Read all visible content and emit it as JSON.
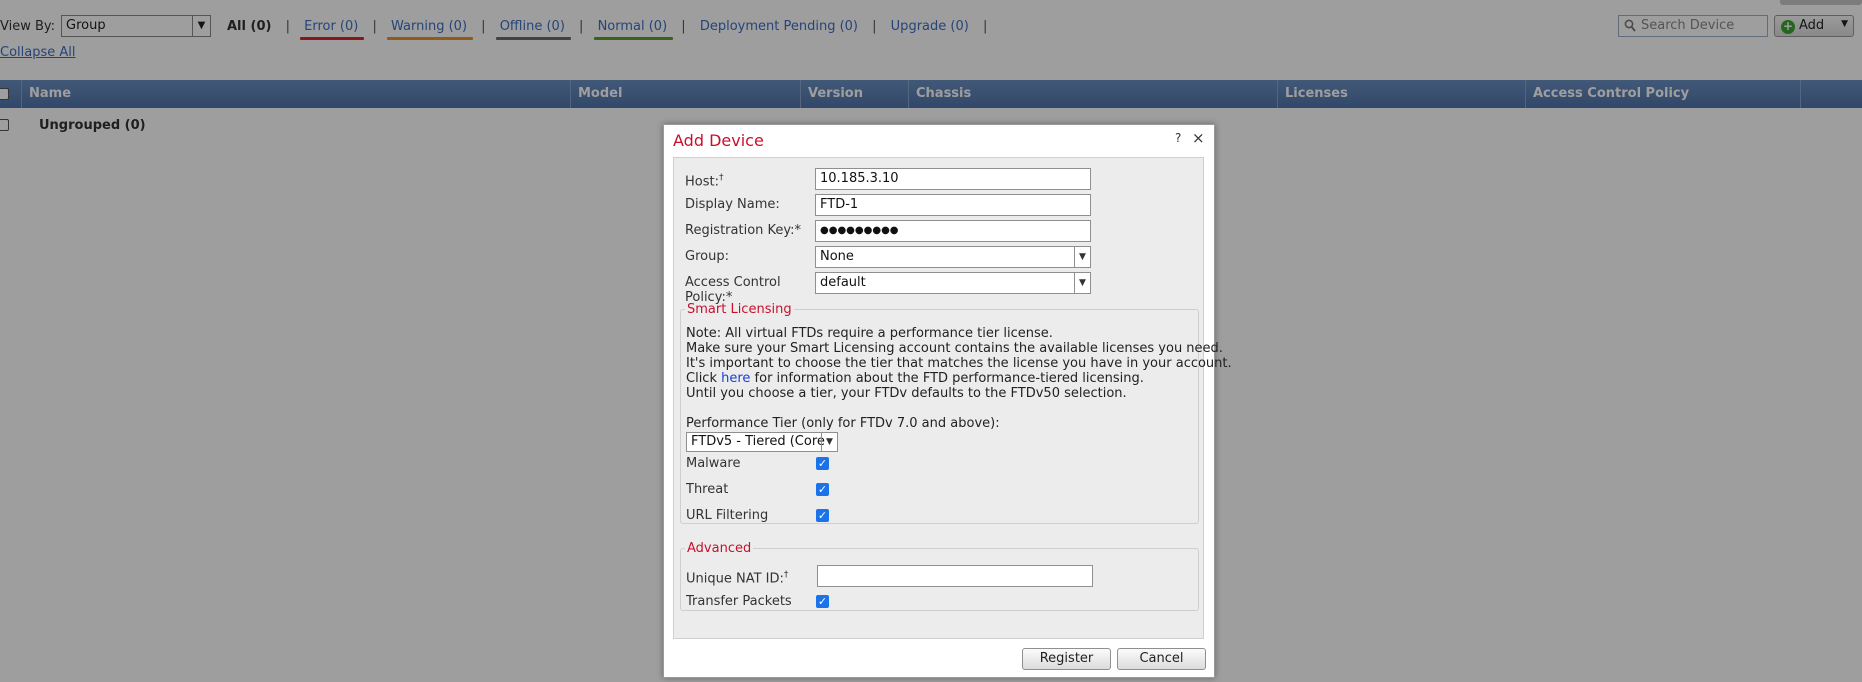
{
  "toolbar": {
    "viewby_label": "View By:",
    "viewby_value": "Group",
    "filters": {
      "all": "All (0)",
      "error": "Error (0)",
      "warning": "Warning (0)",
      "offline": "Offline (0)",
      "normal": "Normal (0)",
      "deployment_pending": "Deployment Pending (0)",
      "upgrade": "Upgrade (0)",
      "separator": "|"
    },
    "collapse_all": "Collapse All",
    "search_placeholder": "Search Device",
    "add_label": "Add"
  },
  "colors": {
    "error": "#d9262a",
    "warning": "#e8912a",
    "offline": "#6b6b6b",
    "normal": "#5aa02c",
    "header": "#5a7fb5",
    "title_red": "#c8102e"
  },
  "table": {
    "columns": [
      "Name",
      "Model",
      "Version",
      "Chassis",
      "Licenses",
      "Access Control Policy"
    ],
    "group_label": "Ungrouped (0)"
  },
  "dialog": {
    "title": "Add Device",
    "help": "?",
    "close": "×",
    "host_label": "Host:",
    "host_mark": "†",
    "host_value": "10.185.3.10",
    "display_name_label": "Display Name:",
    "display_name_value": "FTD-1",
    "reg_key_label": "Registration Key:",
    "reg_key_mark": "*",
    "reg_key_value": "●●●●●●●●●",
    "group_label": "Group:",
    "group_value": "None",
    "acp_label_1": "Access Control",
    "acp_label_2": "Policy:*",
    "acp_value": "default",
    "smart_licensing": {
      "legend": "Smart Licensing",
      "note_1": "Note: All virtual FTDs require a performance tier license.",
      "note_2": "Make sure your Smart Licensing account contains the available licenses you need.",
      "note_3": "It's important to choose the tier that matches the license you have in your account.",
      "note_4_pre": "Click ",
      "note_4_link": "here",
      "note_4_post": " for information about the FTD performance-tiered licensing.",
      "note_5": "Until you choose a tier, your FTDv defaults to the FTDv50 selection.",
      "tier_label": "Performance Tier (only for FTDv 7.0 and above):",
      "tier_value": "FTDv5 - Tiered (Core",
      "malware_label": "Malware",
      "threat_label": "Threat",
      "url_label": "URL Filtering",
      "check": "✓"
    },
    "advanced": {
      "legend": "Advanced",
      "nat_label": "Unique NAT ID:",
      "nat_mark": "†",
      "nat_value": "",
      "transfer_label": "Transfer Packets"
    },
    "register_button": "Register",
    "cancel_button": "Cancel"
  }
}
